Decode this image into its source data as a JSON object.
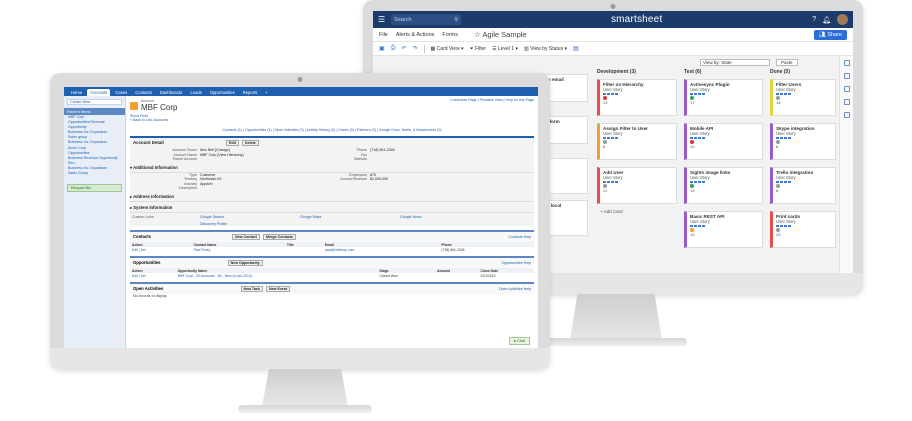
{
  "smartsheet": {
    "search_placeholder": "Search",
    "logo": "smartsheet",
    "menu": [
      "File",
      "Alerts & Actions",
      "Forms"
    ],
    "sheet_name": "Agile Sample",
    "share_label": "Share",
    "toolbar": {
      "card_view": "Card View",
      "filter": "Filter",
      "level": "Level 1",
      "view_by": "View by Status"
    },
    "view_by_select": "View by: State",
    "paste_label": "Paste",
    "add_card": "+ Add Card",
    "lanes": [
      {
        "title": "",
        "cards": [
          {
            "title": "...om email",
            "sub": "",
            "num": "",
            "color": "#e84c4c"
          },
          {
            "title": "...rs form",
            "sub": "",
            "num": "",
            "color": "#e84c4c"
          },
          {
            "title": "",
            "sub": "",
            "num": "",
            "color": "#e84c4c"
          },
          {
            "title": "...on local",
            "sub": "",
            "num": "",
            "color": "#e84c4c"
          }
        ]
      },
      {
        "title": "Development (3)",
        "cards": [
          {
            "title": "Filter on Hierarchy",
            "sub": "User Story",
            "num": "13",
            "color": "#e84c4c",
            "dot": "#d33"
          },
          {
            "title": "Assign Filter to User",
            "sub": "User Story",
            "num": "8",
            "color": "#f0a030",
            "dot": "#999"
          },
          {
            "title": "Add User",
            "sub": "User Story",
            "num": "21",
            "color": "#e84c4c",
            "dot": "#999"
          }
        ]
      },
      {
        "title": "Test (6)",
        "cards": [
          {
            "title": "Activesync Plugin",
            "sub": "User Story",
            "num": "17",
            "color": "#9b59d0",
            "dot": "#2aa84a"
          },
          {
            "title": "Mobile API",
            "sub": "User Story",
            "num": "10",
            "color": "#9b59d0",
            "dot": "#d33"
          },
          {
            "title": "Sights image links",
            "sub": "User Story",
            "num": "13",
            "color": "#9b59d0",
            "dot": "#2aa84a"
          },
          {
            "title": "Basic REST API",
            "sub": "User Story",
            "num": "13",
            "color": "#9b59d0",
            "dot": "#f0a030"
          }
        ]
      },
      {
        "title": "Done (5)",
        "cards": [
          {
            "title": "Filter Users",
            "sub": "User Story",
            "num": "14",
            "color": "#e8d23c",
            "dot": "#999"
          },
          {
            "title": "Skype integration",
            "sub": "User Story",
            "num": "8",
            "color": "#9b59d0",
            "dot": "#999"
          },
          {
            "title": "Trello integration",
            "sub": "User Story",
            "num": "8",
            "color": "#9b59d0",
            "dot": "#999"
          },
          {
            "title": "Print cards",
            "sub": "User Story",
            "num": "23",
            "color": "#e84c4c",
            "dot": "#999"
          }
        ]
      }
    ]
  },
  "salesforce": {
    "tabs": [
      "Home",
      "Accounts",
      "Cases",
      "Contacts",
      "Dashboards",
      "Leads",
      "Opportunities",
      "Reports",
      "+"
    ],
    "active_tab": "Accounts",
    "sidebar": {
      "create_new": "Create New...",
      "recent_header": "Recent Items",
      "recent_items": [
        "MBF Corp",
        "Opportunities Revenue Opportunity",
        "Business Inc. Expansion",
        "Sales group",
        "Business Inc. Expansion",
        "Acme Corp",
        "Opportunities",
        "Business Revenue Opportunity Rev...",
        "Business Inc. Expansion",
        "Sales Group"
      ],
      "recycle_bin": "Recycle Bin"
    },
    "account": {
      "object_label": "Account",
      "name": "MBF Corp",
      "top_links": "Customize Page | Printable View | Help for this Page",
      "feed_link": "Show Feed",
      "back_link": "« Back to List: Accounts",
      "related_links": "Contacts (1) | Opportunities (1) | Open Activities (0) | Activity History (0) | Cases (0) | Partners (0) | Google Docs, Notes, & Attachments (0)",
      "detail_title": "Account Detail",
      "edit_label": "Edit",
      "delete_label": "Delete",
      "fields": [
        {
          "label": "Account Owner",
          "value": "Alex Bell [Change]",
          "label2": "Phone",
          "value2": "(718) 661-2345"
        },
        {
          "label": "Account Name",
          "value": "MBF Corp [View Hierarchy]",
          "label2": "Fax",
          "value2": ""
        },
        {
          "label": "Parent Account",
          "value": "",
          "label2": "Website",
          "value2": ""
        }
      ],
      "additional_title": "Additional Information",
      "additional_fields": [
        {
          "label": "Type",
          "value": "Customer",
          "label2": "Employees",
          "value2": "870"
        },
        {
          "label": "Territory",
          "value": "Northeast US",
          "label2": "Annual Revenue",
          "value2": "$1,000,000"
        },
        {
          "label": "Industry",
          "value": "Apparel",
          "label2": "",
          "value2": ""
        },
        {
          "label": "Description",
          "value": "",
          "label2": "",
          "value2": ""
        }
      ],
      "address_title": "Address Information",
      "system_title": "System Information",
      "custom_links_title": "Custom Links",
      "custom_links": [
        "Google Search",
        "Google Maps",
        "Google News",
        "Discovery Profile"
      ]
    },
    "contacts": {
      "title": "Contacts",
      "new_label": "New Contact",
      "merge_label": "Merge Contacts",
      "help": "Contacts Help",
      "headers": [
        "Action",
        "Contact Name",
        "Title",
        "Email",
        "Phone"
      ],
      "rows": [
        [
          "Edit | Del",
          "Paul Finley",
          "",
          "paul@mbfcorp.com",
          "(718) 661-2345"
        ]
      ]
    },
    "opportunities": {
      "title": "Opportunities",
      "new_label": "New Opportunity",
      "help": "Opportunities Help",
      "headers": [
        "Action",
        "Opportunity Name",
        "Stage",
        "Amount",
        "Close Date"
      ],
      "rows": [
        [
          "Edit | Del",
          "MBF Corp - 20 Accounts - 5K - New (6-Jan-2013)",
          "Closed Won",
          "",
          "2/21/2013"
        ]
      ]
    },
    "activities": {
      "title": "Open Activities",
      "new_task": "New Task",
      "new_event": "New Event",
      "help": "Open Activities Help",
      "empty": "No records to display"
    },
    "chat_label": "Chat"
  }
}
